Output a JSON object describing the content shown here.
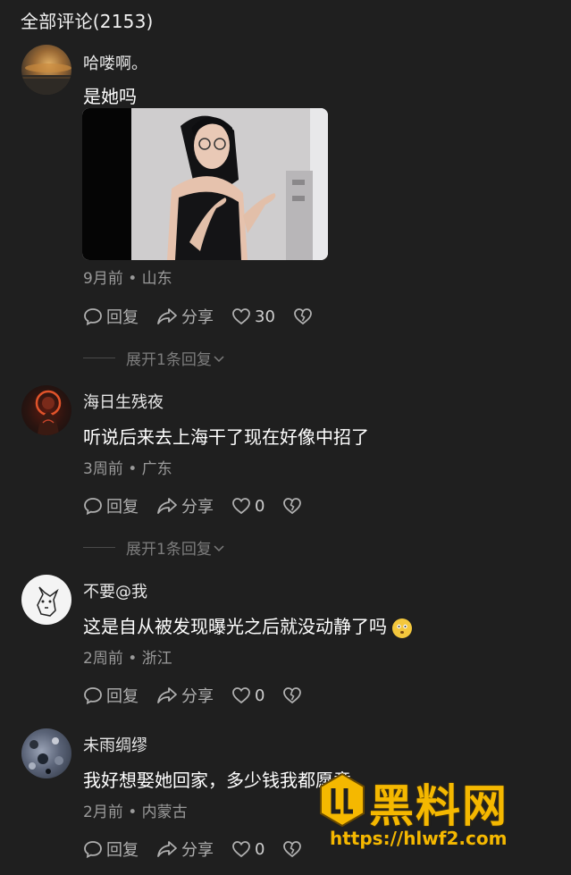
{
  "header": {
    "title": "全部评论(2153)"
  },
  "comments": [
    {
      "username": "哈喽啊。",
      "text": "是她吗",
      "meta": "9月前 • 山东",
      "reply": "回复",
      "share": "分享",
      "likes": "30",
      "expand": "展开1条回复"
    },
    {
      "username": "海日生残夜",
      "text": "听说后来去上海干了现在好像中招了",
      "meta": "3周前 • 广东",
      "reply": "回复",
      "share": "分享",
      "likes": "0",
      "expand": "展开1条回复"
    },
    {
      "username": "不要@我",
      "text": "这是自从被发现曝光之后就没动静了吗",
      "meta": "2周前 • 浙江",
      "reply": "回复",
      "share": "分享",
      "likes": "0"
    },
    {
      "username": "未雨绸缪",
      "text": "我好想娶她回家，多少钱我都愿意",
      "meta": "2月前 • 内蒙古",
      "reply": "回复",
      "share": "分享",
      "likes": "0"
    }
  ],
  "watermark": {
    "title": "黑料网",
    "url": "https://hlwf2.com"
  }
}
